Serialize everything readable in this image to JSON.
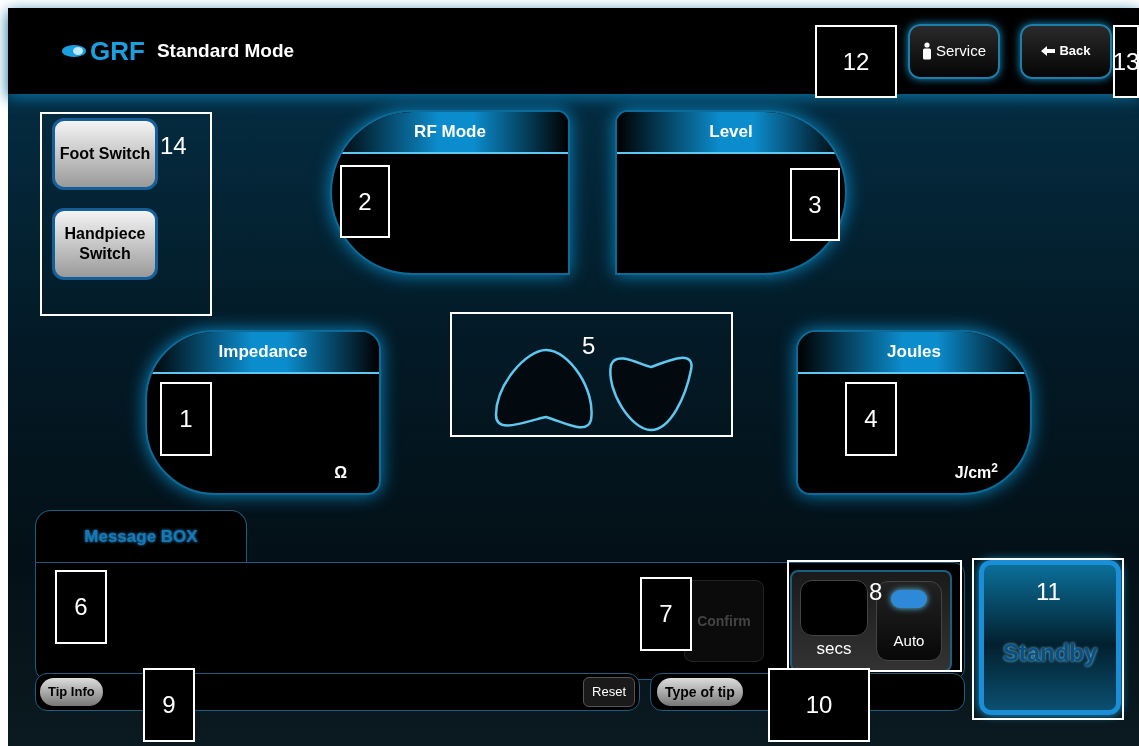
{
  "header": {
    "logo": "GRF",
    "title": "Standard Mode",
    "buttons": [
      {
        "kind": "service",
        "label": "Service"
      },
      {
        "kind": "back",
        "label": "Back"
      }
    ]
  },
  "switches": [
    {
      "label": "Foot Switch"
    },
    {
      "label": "Handpiece Switch"
    }
  ],
  "panels": [
    {
      "title": "RF Mode"
    },
    {
      "title": "Level"
    },
    {
      "title": "Impedance",
      "unit": "Ω"
    },
    {
      "title": "Joules",
      "unit": "J/cm$^{2}$"
    }
  ],
  "message_box": {
    "tab": "Message BOX",
    "confirm": {
      "label": "Confirm",
      "disabled": true
    },
    "timer": {
      "unit": "secs",
      "auto_label": "Auto",
      "auto_on": true
    }
  },
  "standby": {
    "label": "Standby"
  },
  "bottom_bar": {
    "tip_info": "Tip Info",
    "reset": "Reset",
    "type_of_tip": "Type of tip"
  },
  "callouts": [
    "12",
    "13",
    "14",
    "2",
    "3",
    "5",
    "1",
    "4",
    "6",
    "7",
    "8",
    "11",
    "9",
    "10"
  ]
}
